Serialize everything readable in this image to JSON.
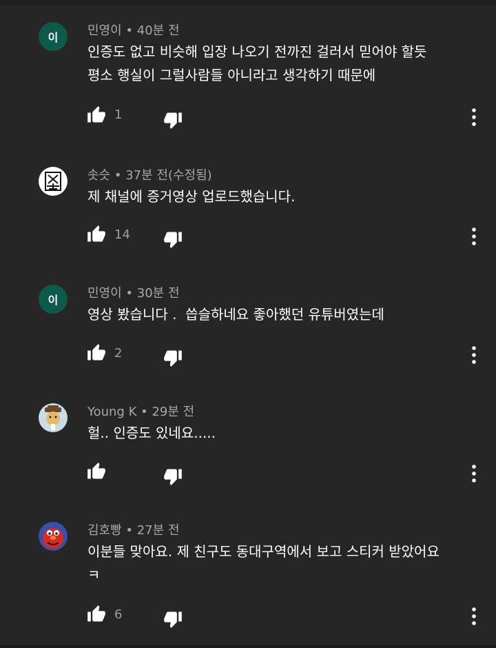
{
  "comments": [
    {
      "avatar_text": "이",
      "avatar_kind": "initial",
      "author": "민영이",
      "separator": "•",
      "time": "40분 전",
      "text": "인증도 없고 비슷해 입장 나오기 전까진 걸러서 믿어야 할듯\n평소 행실이 그럴사람들 아니라고 생각하기 때문에",
      "likes": "1"
    },
    {
      "avatar_kind": "logo",
      "author": "솟슷",
      "separator": "•",
      "time": "37분 전(수정됨)",
      "text": "제 채널에 증거영상 업로드했습니다.",
      "likes": "14"
    },
    {
      "avatar_text": "이",
      "avatar_kind": "initial",
      "author": "민영이",
      "separator": "•",
      "time": "30분 전",
      "text": "영상 봤습니다 .  씁슬하네요 좋아했던 유튜버였는데",
      "likes": "2"
    },
    {
      "avatar_kind": "character",
      "author": "Young K",
      "separator": "•",
      "time": "29분 전",
      "text": "헐.. 인증도 있네요.....",
      "likes": ""
    },
    {
      "avatar_kind": "red-monster",
      "author": "김호빵",
      "separator": "•",
      "time": "27분 전",
      "text": "이분들 맞아요. 제 친구도 동대구역에서 보고 스티커 받았어요\nㅋ",
      "likes": "6"
    }
  ],
  "icons": {
    "like": "thumbs-up-icon",
    "dislike": "thumbs-down-icon",
    "more": "more-vert-icon"
  },
  "colors": {
    "background": "#262626",
    "meta_text": "#a8a8a8",
    "initial_avatar": "#0b5a4a"
  }
}
